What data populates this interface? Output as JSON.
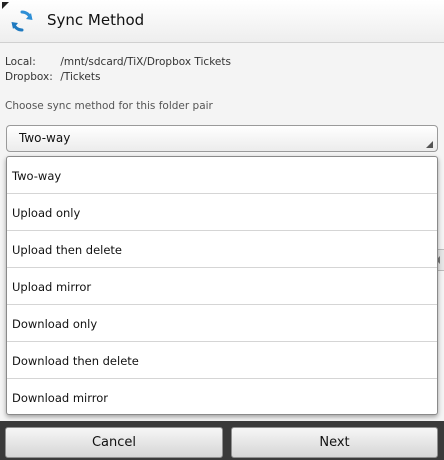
{
  "dialog": {
    "title": "Sync Method",
    "local_label": "Local:",
    "local_path": "/mnt/sdcard/TiX/Dropbox Tickets",
    "dropbox_label": "Dropbox:",
    "dropbox_path": "/Tickets",
    "prompt": "Choose sync method for this folder pair"
  },
  "select": {
    "selected": "Two-way",
    "options": [
      "Two-way",
      "Upload only",
      "Upload then delete",
      "Upload mirror",
      "Download only",
      "Download then delete",
      "Download mirror"
    ]
  },
  "buttons": {
    "cancel": "Cancel",
    "next": "Next"
  },
  "colors": {
    "icon_blue": "#2e8fd6",
    "popup_border": "#8a8a8a",
    "button_bar": "#3a3a3a"
  }
}
